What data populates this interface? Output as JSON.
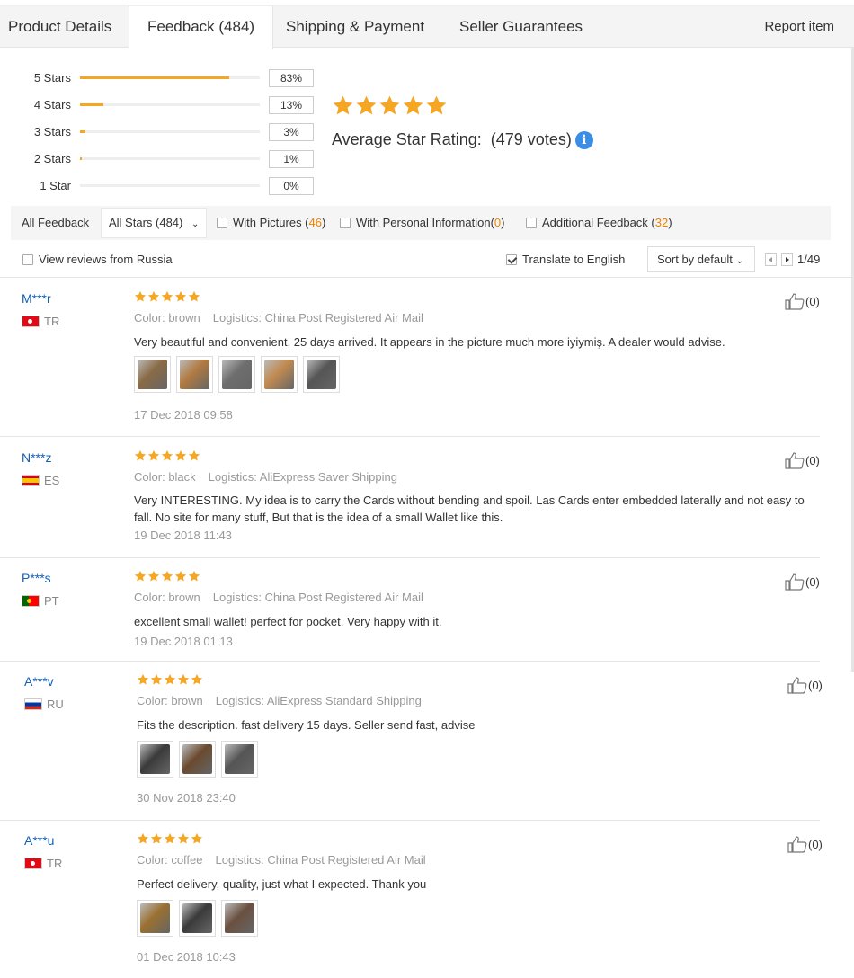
{
  "tabs": [
    {
      "label": "Product Details"
    },
    {
      "label": "Feedback (484)"
    },
    {
      "label": "Shipping & Payment"
    },
    {
      "label": "Seller Guarantees"
    }
  ],
  "report_label": "Report item",
  "histogram": [
    {
      "label": "5 Stars",
      "pct": "83%",
      "value": 0.83
    },
    {
      "label": "4 Stars",
      "pct": "13%",
      "value": 0.13
    },
    {
      "label": "3 Stars",
      "pct": "3%",
      "value": 0.03
    },
    {
      "label": "2 Stars",
      "pct": "1%",
      "value": 0.01
    },
    {
      "label": "1 Star",
      "pct": "0%",
      "value": 0.0
    }
  ],
  "average": {
    "label": "Average Star Rating:",
    "votes": "(479 votes)",
    "info_icon": "info-icon",
    "star_count": 5
  },
  "filters": {
    "all_feedback": "All Feedback",
    "all_stars": "All Stars (484)",
    "with_pictures": "With Pictures (",
    "with_pictures_count": "46",
    "personal_info": "With Personal Information(",
    "personal_info_count": "0",
    "additional": "Additional Feedback (",
    "additional_count": "32",
    "close_paren": ")"
  },
  "options": {
    "view_russia": "View reviews from Russia",
    "translate": "Translate to English",
    "sort": "Sort by default",
    "page": "1/49"
  },
  "colors": {
    "star": "#f5a623",
    "link": "#1060b8",
    "count": "#f08200"
  },
  "reviews": [
    {
      "user": "M***r",
      "country": "TR",
      "flag": "tr",
      "color_label": "Color:",
      "color": "brown",
      "logistics_label": "Logistics:",
      "logistics": "China Post Registered Air Mail",
      "text": "Very beautiful and convenient, 25 days arrived. It appears in the picture much more iyiymiş. A dealer would advise.",
      "photos": 5,
      "date": "17 Dec 2018 09:58",
      "likes": "(0)"
    },
    {
      "user": "N***z",
      "country": "ES",
      "flag": "es",
      "color_label": "Color:",
      "color": "black",
      "logistics_label": "Logistics:",
      "logistics": "AliExpress Saver Shipping",
      "text": "Very INTERESTING. My idea is to carry the Cards without bending and spoil. Las Cards enter embedded laterally and not easy to fall. No site for many stuff, But that is the idea of a small Wallet like this.",
      "photos": 0,
      "date": "19 Dec 2018 11:43",
      "likes": "(0)"
    },
    {
      "user": "P***s",
      "country": "PT",
      "flag": "pt",
      "color_label": "Color:",
      "color": "brown",
      "logistics_label": "Logistics:",
      "logistics": "China Post Registered Air Mail",
      "text": "excellent small wallet! perfect for pocket. Very happy with it.",
      "photos": 0,
      "date": "19 Dec 2018 01:13",
      "likes": "(0)"
    },
    {
      "user": "A***v",
      "country": "RU",
      "flag": "ru",
      "color_label": "Color:",
      "color": "brown",
      "logistics_label": "Logistics:",
      "logistics": "AliExpress Standard Shipping",
      "text": "Fits the description. fast delivery 15 days. Seller send fast, advise",
      "photos": 3,
      "date": "30 Nov 2018 23:40",
      "likes": "(0)"
    },
    {
      "user": "A***u",
      "country": "TR",
      "flag": "tr",
      "color_label": "Color:",
      "color": "coffee",
      "logistics_label": "Logistics:",
      "logistics": "China Post Registered Air Mail",
      "text": "Perfect delivery, quality, just what I expected. Thank you",
      "photos": 3,
      "date": "01 Dec 2018 10:43",
      "likes": "(0)"
    }
  ]
}
